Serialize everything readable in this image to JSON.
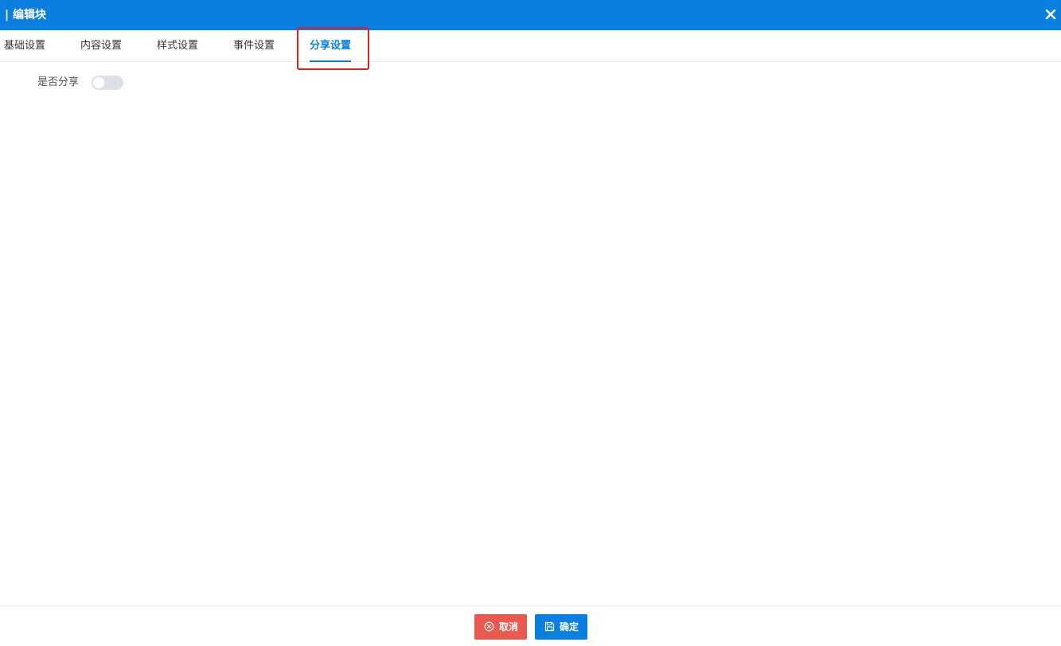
{
  "dialog": {
    "title": "| 编辑块",
    "close_icon": "close-icon"
  },
  "tabs": [
    {
      "label": "基础设置",
      "active": false
    },
    {
      "label": "内容设置",
      "active": false
    },
    {
      "label": "样式设置",
      "active": false
    },
    {
      "label": "事件设置",
      "active": false
    },
    {
      "label": "分享设置",
      "active": true
    }
  ],
  "share_form": {
    "share_label": "是否分享",
    "share_enabled": false
  },
  "footer": {
    "cancel_label": "取消",
    "cancel_icon": "circle-x-icon",
    "confirm_label": "确定",
    "confirm_icon": "save-icon"
  },
  "colors": {
    "primary": "#0b7fdf",
    "danger": "#e8594f",
    "highlight": "#e02020",
    "switch_off": "#dcdfe6"
  }
}
